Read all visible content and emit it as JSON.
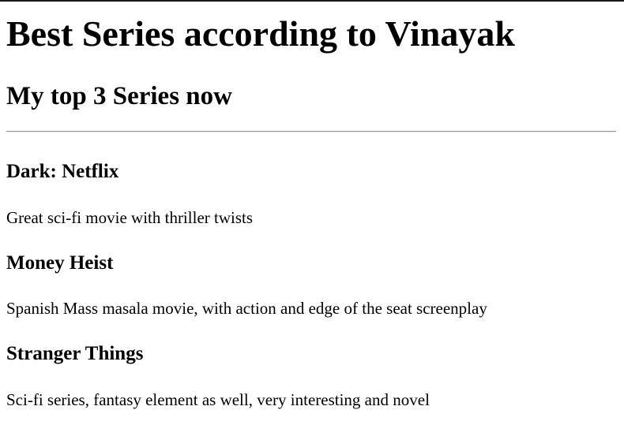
{
  "page": {
    "heading": "Best Series according to Vinayak",
    "subheading": "My top 3 Series now"
  },
  "series": [
    {
      "title": "Dark: Netflix",
      "description": "Great sci-fi movie with thriller twists"
    },
    {
      "title": "Money Heist",
      "description": "Spanish Mass masala movie, with action and edge of the seat screenplay"
    },
    {
      "title": "Stranger Things",
      "description": "Sci-fi series, fantasy element as well, very interesting and novel"
    }
  ]
}
